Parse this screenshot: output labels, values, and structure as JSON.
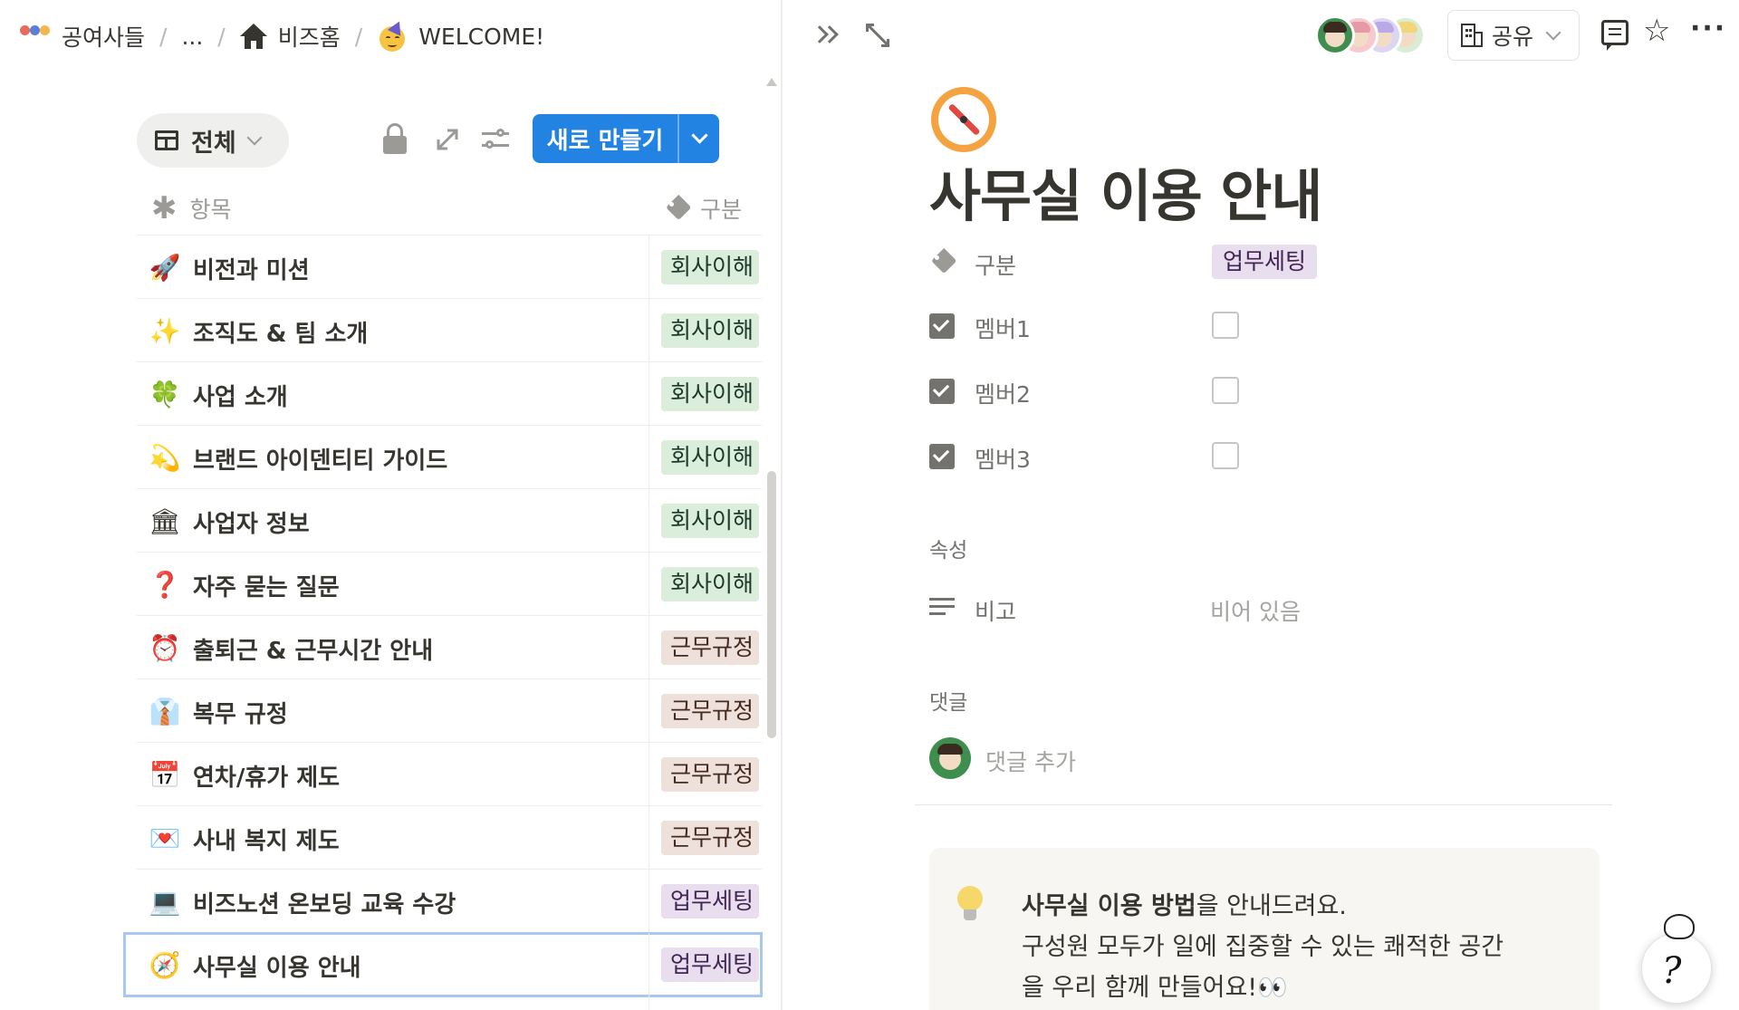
{
  "breadcrumb": {
    "items": [
      {
        "label": "공여사들",
        "icon": "company-logo"
      },
      {
        "label": "..."
      },
      {
        "label": "비즈홈",
        "icon": "house-icon"
      },
      {
        "label": "WELCOME!",
        "icon": "party-face-emoji"
      }
    ],
    "separator": "/"
  },
  "database": {
    "view_label": "전체",
    "new_button_label": "새로 만들기",
    "columns": {
      "name": "항목",
      "tag": "구분"
    },
    "rows": [
      {
        "icon": "🚀",
        "name": "비전과 미션",
        "tag": "회사이해",
        "tag_color": "green"
      },
      {
        "icon": "✨",
        "name": "조직도 & 팀 소개",
        "tag": "회사이해",
        "tag_color": "green"
      },
      {
        "icon": "🍀",
        "name": "사업 소개",
        "tag": "회사이해",
        "tag_color": "green"
      },
      {
        "icon": "💫",
        "name": "브랜드 아이덴티티 가이드",
        "tag": "회사이해",
        "tag_color": "green"
      },
      {
        "icon": "🏛",
        "name": "사업자 정보",
        "tag": "회사이해",
        "tag_color": "green"
      },
      {
        "icon": "❓",
        "name": "자주 묻는 질문",
        "tag": "회사이해",
        "tag_color": "green"
      },
      {
        "icon": "⏰",
        "name": "출퇴근 & 근무시간 안내",
        "tag": "근무규정",
        "tag_color": "brown"
      },
      {
        "icon": "👔",
        "name": "복무 규정",
        "tag": "근무규정",
        "tag_color": "brown"
      },
      {
        "icon": "📅",
        "name": "연차/휴가 제도",
        "tag": "근무규정",
        "tag_color": "brown"
      },
      {
        "icon": "💌",
        "name": "사내 복지 제도",
        "tag": "근무규정",
        "tag_color": "brown"
      },
      {
        "icon": "💻",
        "name": "비즈노션 온보딩 교육 수강",
        "tag": "업무세팅",
        "tag_color": "purple"
      },
      {
        "icon": "🧭",
        "name": "사무실 이용 안내",
        "tag": "업무세팅",
        "tag_color": "purple",
        "selected": true
      }
    ]
  },
  "topbar": {
    "share_label": "공유"
  },
  "page": {
    "icon": "compass-icon",
    "title": "사무실 이용 안내",
    "properties": [
      {
        "name": "구분",
        "type": "tag",
        "value": "업무세팅"
      },
      {
        "name": "멤버1",
        "type": "checkbox",
        "checked": false
      },
      {
        "name": "멤버2",
        "type": "checkbox",
        "checked": false
      },
      {
        "name": "멤버3",
        "type": "checkbox",
        "checked": false
      }
    ],
    "section_props_label": "속성",
    "note_prop": {
      "name": "비고",
      "value": "비어 있음"
    },
    "comments_label": "댓글",
    "comment_placeholder": "댓글 추가",
    "callout": {
      "bold": "사무실 이용 방법",
      "rest1": "을 안내드려요.",
      "line2": "구성원 모두가 일에 집중할 수 있는 쾌적한 공간",
      "line3": "을 우리 함께 만들어요!👀"
    }
  },
  "colors": {
    "accent": "#2383e2",
    "tag_green": "#dbeddb",
    "tag_brown": "#eee0da",
    "tag_purple": "#e8deee"
  }
}
